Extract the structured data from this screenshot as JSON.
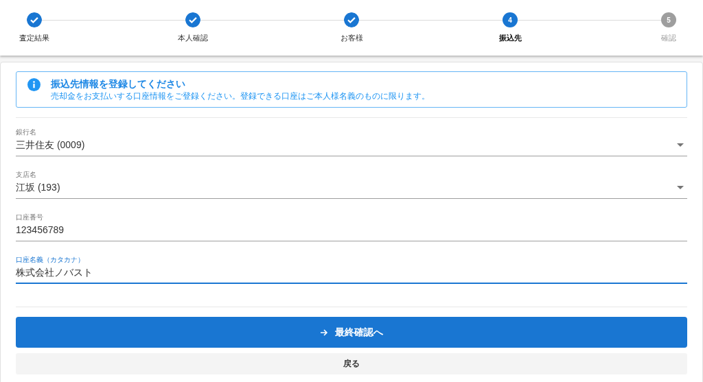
{
  "stepper": {
    "steps": [
      {
        "label": "査定結果",
        "completed": true,
        "selected": false
      },
      {
        "label": "本人確認",
        "completed": true,
        "selected": false
      },
      {
        "label": "お客様",
        "completed": true,
        "selected": false
      },
      {
        "label": "振込先",
        "number": "4",
        "completed": false,
        "selected": true
      },
      {
        "label": "確認",
        "number": "5",
        "completed": false,
        "selected": false
      }
    ]
  },
  "notice": {
    "title": "振込先情報を登録してください",
    "message": "売却金をお支払いする口座情報をご登録ください。登録できる口座はご本人様名義のものに限ります。"
  },
  "fields": [
    {
      "kind": "select",
      "label": "銀行名",
      "value": "三井住友 (0009)",
      "focused": false
    },
    {
      "kind": "select",
      "label": "支店名",
      "value": "江坂 (193)",
      "focused": false
    },
    {
      "kind": "text",
      "label": "口座番号",
      "value": "123456789",
      "focused": false
    },
    {
      "kind": "text",
      "label": "口座名義（カタカナ）",
      "value": "株式会社ノバスト",
      "focused": true
    }
  ],
  "primary_button": {
    "label": "最終確認へ"
  },
  "back_button": {
    "label": "戻る"
  }
}
